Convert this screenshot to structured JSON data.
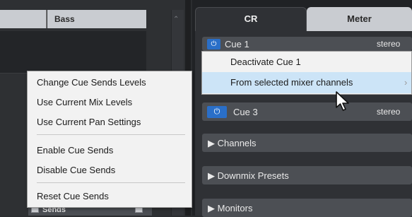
{
  "mixer": {
    "channel_name": "Bass",
    "sends_label": "Sends"
  },
  "tabs": {
    "cr": "CR",
    "meter": "Meter"
  },
  "cues": {
    "cue1_label": "Cue 1",
    "cue1_format": "stereo",
    "cue3_label": "Cue 3",
    "cue3_format": "stereo"
  },
  "sections": {
    "channels": "Channels",
    "downmix": "Downmix Presets",
    "monitors": "Monitors"
  },
  "cue_menu": {
    "items": [
      "Deactivate Cue 1",
      "From selected mixer channels"
    ],
    "highlighted_index": 1
  },
  "submenu": {
    "items": [
      "Change Cue Sends Levels",
      "Use Current Mix Levels",
      "Use Current Pan Settings",
      "Enable Cue Sends",
      "Disable Cue Sends",
      "Reset Cue Sends"
    ]
  },
  "icons": {
    "power": "power-icon",
    "expand": "triangle-right-icon",
    "submenu": "chevron-right-icon",
    "cursor": "mouse-pointer-icon"
  },
  "colors": {
    "accent": "#2a6fc8",
    "highlight": "#cce4f7"
  }
}
